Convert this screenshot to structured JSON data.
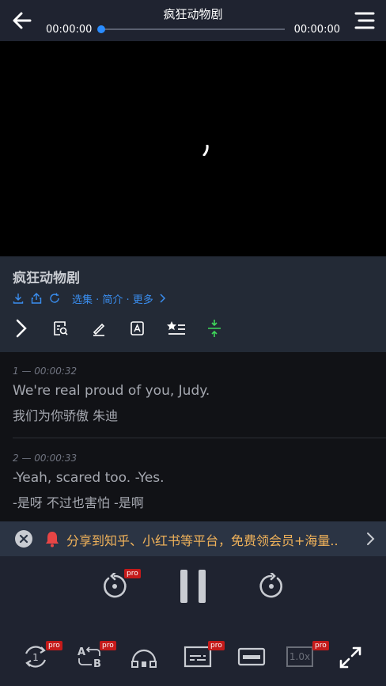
{
  "topbar": {
    "title": "疯狂动物剧",
    "time_current": "00:00:00",
    "time_total": "00:00:00",
    "progress": 0
  },
  "info": {
    "title": "疯狂动物剧",
    "links": "选集 · 简介 · 更多"
  },
  "subtitles": [
    {
      "index": "1 — 00:00:32",
      "en": "We're real proud of you, Judy.",
      "zh": "我们为你骄傲 朱迪"
    },
    {
      "index": "2 — 00:00:33",
      "en": "-Yeah, scared too. -Yes.",
      "zh": "-是呀 不过也害怕 -是啊"
    }
  ],
  "banner": {
    "text": "分享到知乎、小红书等平台，免费领会员+海量.."
  },
  "controls": {
    "pro_label": "pro",
    "speed_label": "1.0x"
  },
  "colors": {
    "accent": "#2a8cff",
    "link": "#3a8ef0",
    "banner_text": "#f0b25a",
    "pro_badge": "#c41a1a"
  }
}
